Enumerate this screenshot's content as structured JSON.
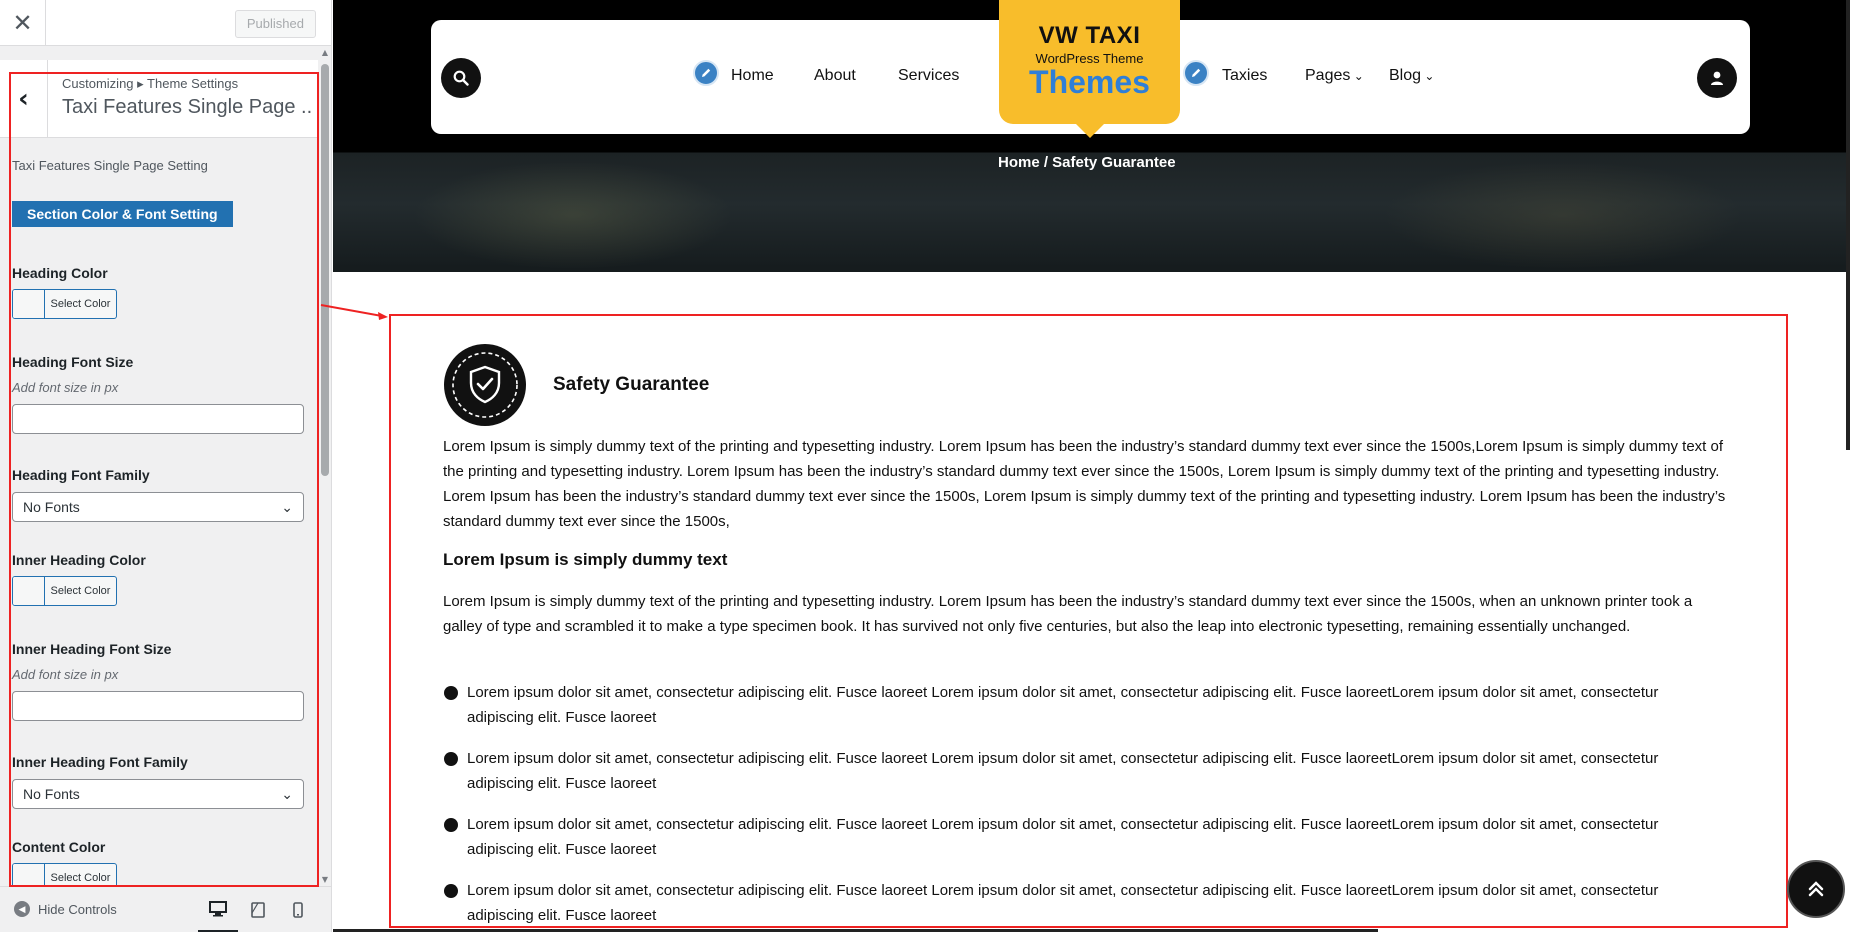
{
  "sidebar": {
    "published_label": "Published",
    "breadcrumb": "Customizing ▸ Theme Settings",
    "section_title": "Taxi Features Single Page ...",
    "description": "Taxi Features Single Page Setting",
    "section_button": "Section Color & Font Setting",
    "controls": {
      "heading_color": {
        "label": "Heading Color",
        "button": "Select Color"
      },
      "heading_font_size": {
        "label": "Heading Font Size",
        "help": "Add font size in px"
      },
      "heading_font_family": {
        "label": "Heading Font Family",
        "value": "No Fonts"
      },
      "inner_heading_color": {
        "label": "Inner Heading Color",
        "button": "Select Color"
      },
      "inner_heading_font_size": {
        "label": "Inner Heading Font Size",
        "help": "Add font size in px"
      },
      "inner_heading_font_family": {
        "label": "Inner Heading Font Family",
        "value": "No Fonts"
      },
      "content_color": {
        "label": "Content Color",
        "button": "Select Color"
      }
    },
    "footer": {
      "hide_controls": "Hide Controls"
    }
  },
  "preview": {
    "nav": {
      "left_items": [
        "Home",
        "About",
        "Services"
      ],
      "right_items": [
        "Taxies",
        "Pages",
        "Blog"
      ]
    },
    "logo": {
      "title": "VW TAXI",
      "subtitle": "WordPress Theme",
      "brand": "Themes"
    },
    "breadcrumb": "Home / Safety Guarantee",
    "feature": {
      "title": "Safety Guarantee",
      "intro": "Lorem Ipsum is simply dummy text of the printing and typesetting industry. Lorem Ipsum has been the industry’s standard dummy text ever since the 1500s,Lorem Ipsum is simply dummy text of the printing and typesetting industry. Lorem Ipsum has been the industry’s standard dummy text ever since the 1500s, Lorem Ipsum is simply dummy text of the printing and typesetting industry. Lorem Ipsum has been the industry’s standard dummy text ever since the 1500s, Lorem Ipsum is simply dummy text of the printing and typesetting industry. Lorem Ipsum has been the industry’s standard dummy text ever since the 1500s,",
      "subheading": "Lorem Ipsum is simply dummy text",
      "body": "Lorem Ipsum is simply dummy text of the printing and typesetting industry. Lorem Ipsum has been the industry’s standard dummy text ever since the 1500s, when an unknown printer took a galley of type and scrambled it to make a type specimen book. It has survived not only five centuries, but also the leap into electronic typesetting, remaining essentially unchanged.",
      "bullets": [
        "Lorem ipsum dolor sit amet, consectetur adipiscing elit. Fusce laoreet Lorem ipsum dolor sit amet, consectetur adipiscing elit. Fusce laoreetLorem ipsum dolor sit amet, consectetur adipiscing elit. Fusce laoreet",
        "Lorem ipsum dolor sit amet, consectetur adipiscing elit. Fusce laoreet Lorem ipsum dolor sit amet, consectetur adipiscing elit. Fusce laoreetLorem ipsum dolor sit amet, consectetur adipiscing elit. Fusce laoreet",
        "Lorem ipsum dolor sit amet, consectetur adipiscing elit. Fusce laoreet Lorem ipsum dolor sit amet, consectetur adipiscing elit. Fusce laoreetLorem ipsum dolor sit amet, consectetur adipiscing elit. Fusce laoreet",
        "Lorem ipsum dolor sit amet, consectetur adipiscing elit. Fusce laoreet Lorem ipsum dolor sit amet, consectetur adipiscing elit. Fusce laoreetLorem ipsum dolor sit amet, consectetur adipiscing elit. Fusce laoreet"
      ]
    }
  },
  "colors": {
    "accent": "#2271b1",
    "logo_bg": "#f8bd2b",
    "brand_blue": "#2f7fd8",
    "highlight": "#ee2222"
  },
  "icons": [
    "close-icon",
    "back-arrow-icon",
    "search-icon",
    "user-icon",
    "pencil-icon",
    "chevron-down-icon",
    "shield-check-icon",
    "arrow-up-icon",
    "desktop-icon",
    "tablet-icon",
    "mobile-icon"
  ]
}
